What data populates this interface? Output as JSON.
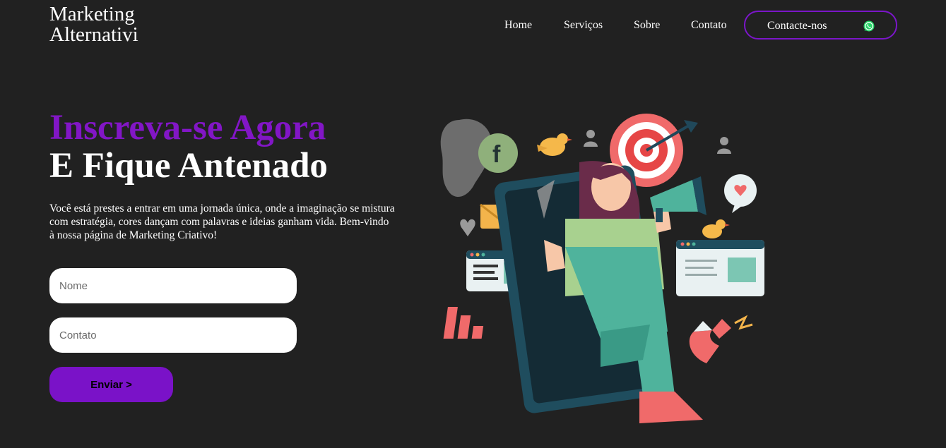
{
  "header": {
    "logo_line1": "Marketing",
    "logo_line2": "Alternativi",
    "nav": [
      "Home",
      "Serviços",
      "Sobre",
      "Contato"
    ],
    "contact_button": "Contacte-nos",
    "contact_icon": "whatsapp-icon"
  },
  "hero": {
    "title_line1": "Inscreva-se Agora",
    "title_line2": "E Fique Antenado",
    "description": "Você está prestes a entrar em uma jornada única, onde a imaginação se mistura com estratégia, cores dançam com palavras e ideias ganham vida. Bem-vindo à nossa página de Marketing Criativo!"
  },
  "form": {
    "name_placeholder": "Nome",
    "contact_placeholder": "Contato",
    "submit_label": "Enviar >"
  },
  "colors": {
    "background": "#212121",
    "accent": "#7b16c9",
    "text": "#ffffff"
  },
  "illustration": {
    "icons": [
      "facebook-icon",
      "target-icon",
      "megaphone-icon",
      "heart-icon",
      "envelope-icon",
      "magnet-icon",
      "bar-chart-icon",
      "bird-icon",
      "user-icon",
      "smartphone-icon"
    ]
  }
}
